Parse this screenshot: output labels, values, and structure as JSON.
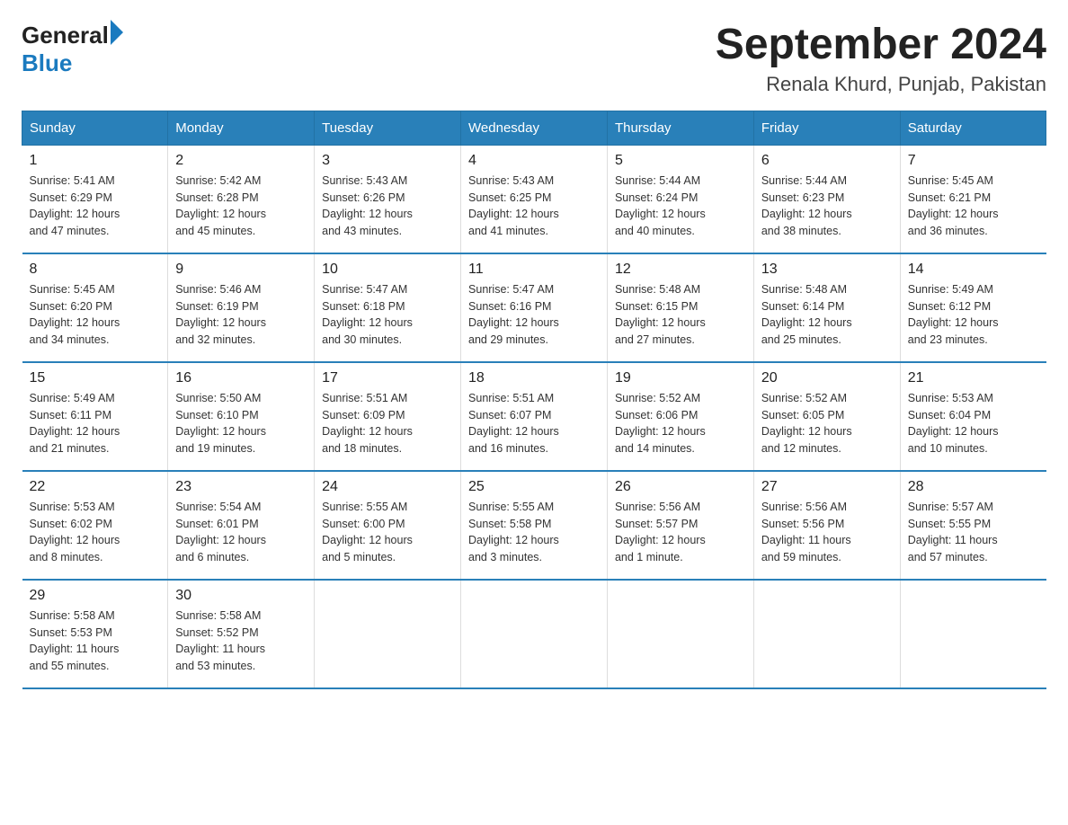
{
  "header": {
    "logo_general": "General",
    "logo_blue": "Blue",
    "title": "September 2024",
    "subtitle": "Renala Khurd, Punjab, Pakistan"
  },
  "columns": [
    "Sunday",
    "Monday",
    "Tuesday",
    "Wednesday",
    "Thursday",
    "Friday",
    "Saturday"
  ],
  "weeks": [
    [
      {
        "day": "1",
        "info": "Sunrise: 5:41 AM\nSunset: 6:29 PM\nDaylight: 12 hours\nand 47 minutes."
      },
      {
        "day": "2",
        "info": "Sunrise: 5:42 AM\nSunset: 6:28 PM\nDaylight: 12 hours\nand 45 minutes."
      },
      {
        "day": "3",
        "info": "Sunrise: 5:43 AM\nSunset: 6:26 PM\nDaylight: 12 hours\nand 43 minutes."
      },
      {
        "day": "4",
        "info": "Sunrise: 5:43 AM\nSunset: 6:25 PM\nDaylight: 12 hours\nand 41 minutes."
      },
      {
        "day": "5",
        "info": "Sunrise: 5:44 AM\nSunset: 6:24 PM\nDaylight: 12 hours\nand 40 minutes."
      },
      {
        "day": "6",
        "info": "Sunrise: 5:44 AM\nSunset: 6:23 PM\nDaylight: 12 hours\nand 38 minutes."
      },
      {
        "day": "7",
        "info": "Sunrise: 5:45 AM\nSunset: 6:21 PM\nDaylight: 12 hours\nand 36 minutes."
      }
    ],
    [
      {
        "day": "8",
        "info": "Sunrise: 5:45 AM\nSunset: 6:20 PM\nDaylight: 12 hours\nand 34 minutes."
      },
      {
        "day": "9",
        "info": "Sunrise: 5:46 AM\nSunset: 6:19 PM\nDaylight: 12 hours\nand 32 minutes."
      },
      {
        "day": "10",
        "info": "Sunrise: 5:47 AM\nSunset: 6:18 PM\nDaylight: 12 hours\nand 30 minutes."
      },
      {
        "day": "11",
        "info": "Sunrise: 5:47 AM\nSunset: 6:16 PM\nDaylight: 12 hours\nand 29 minutes."
      },
      {
        "day": "12",
        "info": "Sunrise: 5:48 AM\nSunset: 6:15 PM\nDaylight: 12 hours\nand 27 minutes."
      },
      {
        "day": "13",
        "info": "Sunrise: 5:48 AM\nSunset: 6:14 PM\nDaylight: 12 hours\nand 25 minutes."
      },
      {
        "day": "14",
        "info": "Sunrise: 5:49 AM\nSunset: 6:12 PM\nDaylight: 12 hours\nand 23 minutes."
      }
    ],
    [
      {
        "day": "15",
        "info": "Sunrise: 5:49 AM\nSunset: 6:11 PM\nDaylight: 12 hours\nand 21 minutes."
      },
      {
        "day": "16",
        "info": "Sunrise: 5:50 AM\nSunset: 6:10 PM\nDaylight: 12 hours\nand 19 minutes."
      },
      {
        "day": "17",
        "info": "Sunrise: 5:51 AM\nSunset: 6:09 PM\nDaylight: 12 hours\nand 18 minutes."
      },
      {
        "day": "18",
        "info": "Sunrise: 5:51 AM\nSunset: 6:07 PM\nDaylight: 12 hours\nand 16 minutes."
      },
      {
        "day": "19",
        "info": "Sunrise: 5:52 AM\nSunset: 6:06 PM\nDaylight: 12 hours\nand 14 minutes."
      },
      {
        "day": "20",
        "info": "Sunrise: 5:52 AM\nSunset: 6:05 PM\nDaylight: 12 hours\nand 12 minutes."
      },
      {
        "day": "21",
        "info": "Sunrise: 5:53 AM\nSunset: 6:04 PM\nDaylight: 12 hours\nand 10 minutes."
      }
    ],
    [
      {
        "day": "22",
        "info": "Sunrise: 5:53 AM\nSunset: 6:02 PM\nDaylight: 12 hours\nand 8 minutes."
      },
      {
        "day": "23",
        "info": "Sunrise: 5:54 AM\nSunset: 6:01 PM\nDaylight: 12 hours\nand 6 minutes."
      },
      {
        "day": "24",
        "info": "Sunrise: 5:55 AM\nSunset: 6:00 PM\nDaylight: 12 hours\nand 5 minutes."
      },
      {
        "day": "25",
        "info": "Sunrise: 5:55 AM\nSunset: 5:58 PM\nDaylight: 12 hours\nand 3 minutes."
      },
      {
        "day": "26",
        "info": "Sunrise: 5:56 AM\nSunset: 5:57 PM\nDaylight: 12 hours\nand 1 minute."
      },
      {
        "day": "27",
        "info": "Sunrise: 5:56 AM\nSunset: 5:56 PM\nDaylight: 11 hours\nand 59 minutes."
      },
      {
        "day": "28",
        "info": "Sunrise: 5:57 AM\nSunset: 5:55 PM\nDaylight: 11 hours\nand 57 minutes."
      }
    ],
    [
      {
        "day": "29",
        "info": "Sunrise: 5:58 AM\nSunset: 5:53 PM\nDaylight: 11 hours\nand 55 minutes."
      },
      {
        "day": "30",
        "info": "Sunrise: 5:58 AM\nSunset: 5:52 PM\nDaylight: 11 hours\nand 53 minutes."
      },
      {
        "day": "",
        "info": ""
      },
      {
        "day": "",
        "info": ""
      },
      {
        "day": "",
        "info": ""
      },
      {
        "day": "",
        "info": ""
      },
      {
        "day": "",
        "info": ""
      }
    ]
  ]
}
